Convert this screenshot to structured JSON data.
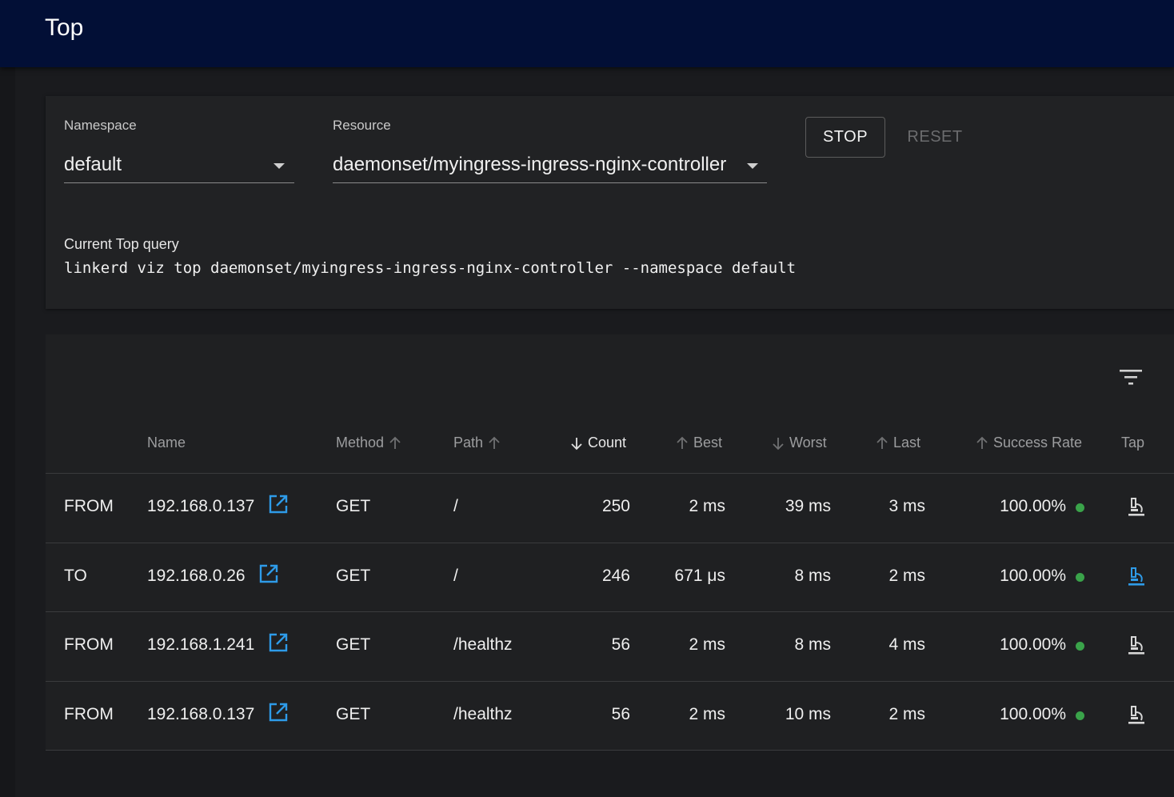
{
  "app_bar": {
    "title": "Top"
  },
  "form": {
    "namespace_label": "Namespace",
    "namespace_value": "default",
    "resource_label": "Resource",
    "resource_value": "daemonset/myingress-ingress-nginx-controller",
    "stop_label": "STOP",
    "reset_label": "RESET",
    "query_label": "Current Top query",
    "query_text": "linkerd viz top daemonset/myingress-ingress-nginx-controller --namespace default"
  },
  "table": {
    "headers": {
      "name": "Name",
      "method": "Method",
      "path": "Path",
      "count": "Count",
      "best": "Best",
      "worst": "Worst",
      "last": "Last",
      "success_rate": "Success Rate",
      "tap": "Tap"
    },
    "rows": [
      {
        "direction": "FROM",
        "name": "192.168.0.137",
        "method": "GET",
        "path": "/",
        "count": "250",
        "best": "2 ms",
        "worst": "39 ms",
        "last": "3 ms",
        "success_rate": "100.00%",
        "tap_active": false
      },
      {
        "direction": "TO",
        "name": "192.168.0.26",
        "method": "GET",
        "path": "/",
        "count": "246",
        "best": "671 μs",
        "worst": "8 ms",
        "last": "2 ms",
        "success_rate": "100.00%",
        "tap_active": true
      },
      {
        "direction": "FROM",
        "name": "192.168.1.241",
        "method": "GET",
        "path": "/healthz",
        "count": "56",
        "best": "2 ms",
        "worst": "8 ms",
        "last": "4 ms",
        "success_rate": "100.00%",
        "tap_active": false
      },
      {
        "direction": "FROM",
        "name": "192.168.0.137",
        "method": "GET",
        "path": "/healthz",
        "count": "56",
        "best": "2 ms",
        "worst": "10 ms",
        "last": "2 ms",
        "success_rate": "100.00%",
        "tap_active": false
      }
    ]
  },
  "icons": {
    "filter": "filter-list-icon",
    "external_link": "open-in-new-icon",
    "tap": "microscope-tap-icon",
    "status_dot": "status-ok-dot"
  },
  "colors": {
    "app_bar": "#020f36",
    "link_blue": "#2e9be8",
    "status_green": "#3aa34a"
  }
}
